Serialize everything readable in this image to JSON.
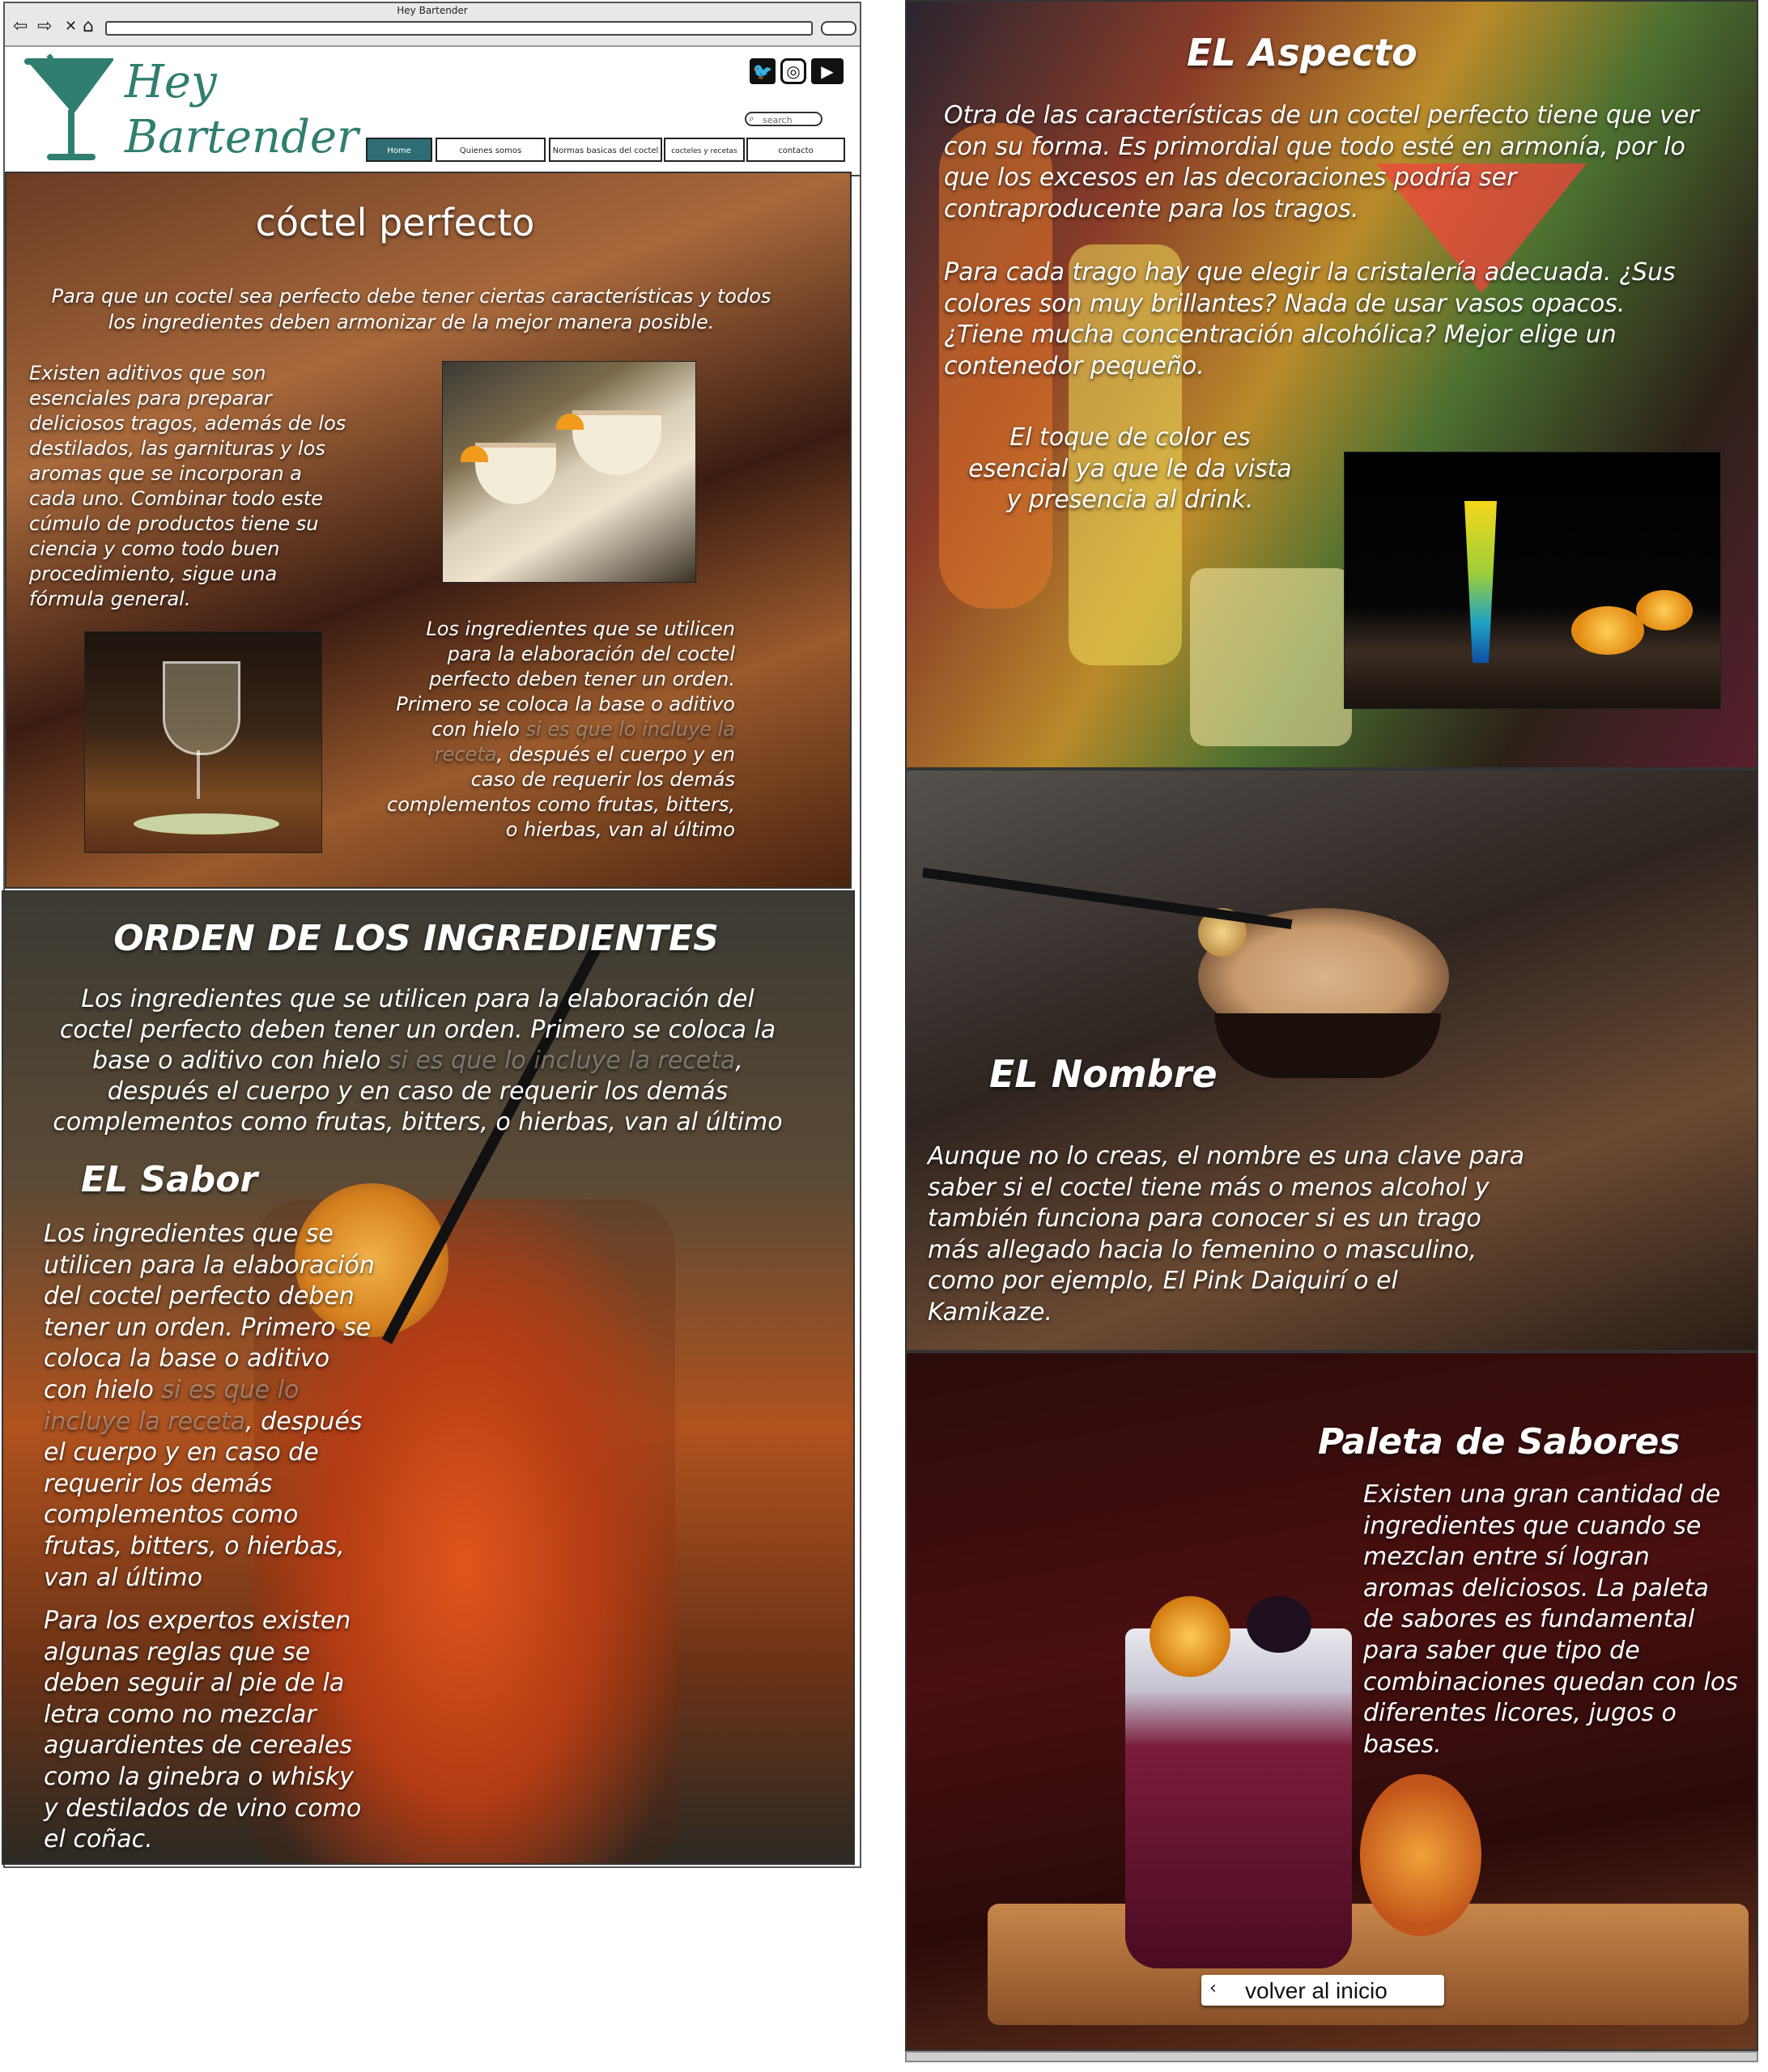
{
  "browser": {
    "title": "Hey Bartender",
    "back_glyph": "⇦",
    "forward_glyph": "⇨",
    "stop_glyph": "✕",
    "home_glyph": "⌂"
  },
  "site": {
    "brand_line1": "Hey",
    "brand_line2": "Bartender",
    "search_placeholder": "search",
    "social": [
      "twitter-icon",
      "instagram-icon",
      "youtube-icon"
    ],
    "nav": [
      {
        "label": "Home",
        "active": true
      },
      {
        "label": "Quienes somos"
      },
      {
        "label": "Normas basicas del coctel"
      },
      {
        "label": "cocteles y recetas"
      },
      {
        "label": "contacto"
      }
    ],
    "accent_color": "#2f6d75",
    "brand_color": "#2f7e70"
  },
  "coctel": {
    "title": "cóctel perfecto",
    "intro": "Para que un coctel sea perfecto debe tener ciertas características y todos los ingredientes deben armonizar de la mejor manera posible.",
    "additives": "Existen aditivos que son esenciales para preparar deliciosos tragos, además de los destilados, las garnituras y los aromas que se incorporan a cada uno. Combinar todo este cúmulo de productos tiene su ciencia y como todo buen procedimiento, sigue una fórmula general.",
    "order_a": "Los ingredientes que se utilicen para la elaboración del coctel perfecto deben tener un orden. Primero se coloca la base o aditivo con hielo ",
    "order_faded": "si es que lo incluye la receta",
    "order_b": ", después el cuerpo y en caso de requerir los demás complementos como frutas, bitters, o hierbas, van al último"
  },
  "orden": {
    "title": "ORDEN DE LOS INGREDIENTES",
    "text_a": "Los ingredientes que se utilicen para la elaboración del coctel perfecto deben tener un orden. Primero se coloca la base o aditivo con hielo ",
    "text_faded": "si es que lo incluye la receta",
    "text_b": ", después el cuerpo y en caso de requerir los demás complementos como frutas, bitters, o hierbas, van al último"
  },
  "sabor": {
    "title": "EL Sabor",
    "text_a": "Los ingredientes que se utilicen para la elaboración del coctel perfecto deben tener un orden. Primero se coloca la base o aditivo con hielo ",
    "text_faded": "si es que lo incluye la receta",
    "text_b": ", después el cuerpo y en caso de requerir los demás complementos como frutas, bitters, o hierbas, van al último",
    "experts": "Para los expertos existen algunas reglas que se deben seguir al pie de la letra como no mezclar aguardientes de cereales como la ginebra o whisky y destilados de vino como el coñac."
  },
  "aspecto": {
    "title": "EL Aspecto",
    "p1": "Otra de las características de un coctel perfecto tiene que ver con su forma. Es primordial que todo esté en armonía, por lo que los excesos en las decoraciones podría ser contraproducente para los tragos.",
    "p2": "Para cada trago hay que elegir la cristalería adecuada. ¿Sus colores son muy brillantes? Nada de usar vasos opacos. ¿Tiene mucha concentración alcohólica? Mejor elige un contenedor pequeño.",
    "p3": "El toque de color es esencial ya que le da vista y presencia al drink."
  },
  "nombre": {
    "title": "EL Nombre",
    "text": "Aunque no lo creas, el nombre es una clave para saber si el coctel tiene más o menos alcohol y también funciona para conocer si es un trago más allegado hacia lo femenino o masculino, como por ejemplo, El Pink Daiquirí o el Kamikaze."
  },
  "paleta": {
    "title": "Paleta de Sabores",
    "text": "Existen una gran cantidad de ingredientes que cuando se mezclan entre sí logran aromas deliciosos. La paleta de sabores es fundamental para saber que tipo de combinaciones quedan con los diferentes licores, jugos o bases.",
    "back_label": "volver al inicio",
    "back_glyph": "‹"
  }
}
